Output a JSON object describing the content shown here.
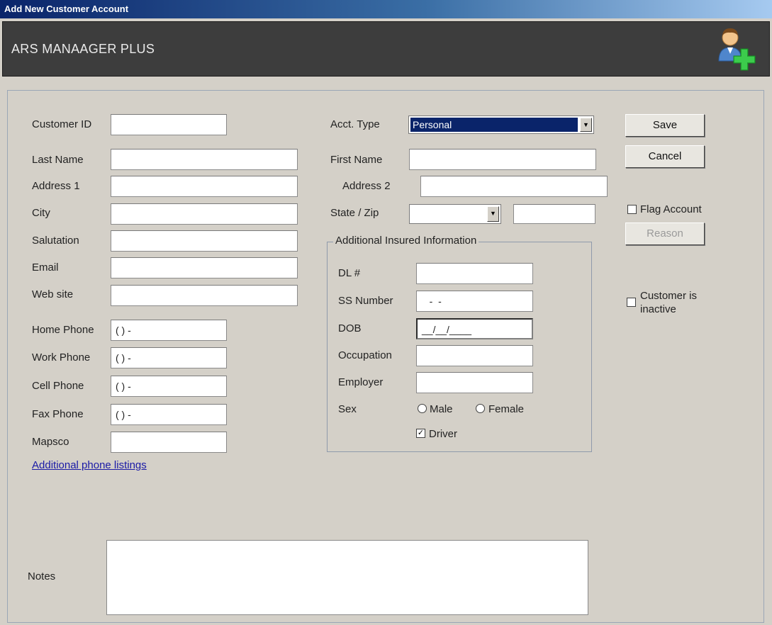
{
  "window": {
    "title": "Add New Customer Account"
  },
  "header": {
    "app_name": "ARS MANAAGER PLUS",
    "icon": "add-user-icon"
  },
  "left": {
    "customer_id": {
      "label": "Customer ID",
      "value": ""
    },
    "last_name": {
      "label": "Last Name",
      "value": ""
    },
    "address1": {
      "label": "Address 1",
      "value": ""
    },
    "city": {
      "label": "City",
      "value": ""
    },
    "salutation": {
      "label": "Salutation",
      "value": ""
    },
    "email": {
      "label": "Email",
      "value": ""
    },
    "website": {
      "label": "Web site",
      "value": ""
    },
    "home_phone": {
      "label": "Home Phone",
      "value": "(    )      -"
    },
    "work_phone": {
      "label": "Work Phone",
      "value": "(    )      -"
    },
    "cell_phone": {
      "label": "Cell Phone",
      "value": "(    )      -"
    },
    "fax_phone": {
      "label": "Fax Phone",
      "value": "(    )      -"
    },
    "mapsco": {
      "label": "Mapsco",
      "value": ""
    },
    "additional_phone_link": "Additional phone listings"
  },
  "middle": {
    "acct_type": {
      "label": "Acct. Type",
      "value": "Personal"
    },
    "first_name": {
      "label": "First Name",
      "value": ""
    },
    "address2": {
      "label": "Address 2",
      "value": ""
    },
    "state_zip": {
      "label": "State / Zip",
      "state": "",
      "zip": ""
    }
  },
  "insured": {
    "title": "Additional Insured Information",
    "dl": {
      "label": "DL #",
      "value": ""
    },
    "ss": {
      "label": "SS Number",
      "value": "   -  -"
    },
    "dob": {
      "label": "DOB",
      "value": "__/__/____"
    },
    "occupation": {
      "label": "Occupation",
      "value": ""
    },
    "employer": {
      "label": "Employer",
      "value": ""
    },
    "sex": {
      "label": "Sex",
      "male": "Male",
      "female": "Female"
    },
    "driver": {
      "label": "Driver",
      "checked": true
    }
  },
  "actions": {
    "save": "Save",
    "cancel": "Cancel",
    "flag_account": "Flag Account",
    "reason": "Reason",
    "inactive_line1": "Customer is",
    "inactive_line2": "inactive"
  },
  "notes": {
    "label": "Notes",
    "value": ""
  },
  "colors": {
    "title_bar": "#0a246a",
    "header_bg": "#3d3d3d",
    "panel_bg": "#d4d0c8",
    "link": "#1a1aa6"
  }
}
